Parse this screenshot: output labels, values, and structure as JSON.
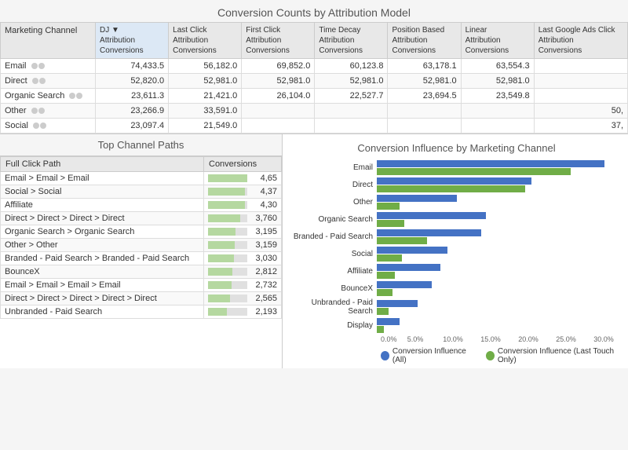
{
  "title": "Conversion Counts by Attribution Model",
  "topTable": {
    "columns": [
      {
        "key": "channel",
        "label": "Marketing Channel"
      },
      {
        "key": "dj",
        "label": "DJ Attribution Conversions",
        "sort": true
      },
      {
        "key": "lastClick",
        "label": "Last Click Attribution Conversions"
      },
      {
        "key": "firstClick",
        "label": "First Click Attribution Conversions"
      },
      {
        "key": "timeDecay",
        "label": "Time Decay Attribution Conversions"
      },
      {
        "key": "positionBased",
        "label": "Position Based Attribution Conversions"
      },
      {
        "key": "linear",
        "label": "Linear Attribution Conversions"
      },
      {
        "key": "lastGoogle",
        "label": "Last Google Ads Click Attribution Conversions"
      }
    ],
    "rows": [
      {
        "channel": "Email",
        "dj": "74,433.5",
        "lastClick": "56,182.0",
        "firstClick": "69,852.0",
        "timeDecay": "60,123.8",
        "positionBased": "63,178.1",
        "linear": "63,554.3",
        "lastGoogle": ""
      },
      {
        "channel": "Direct",
        "dj": "52,820.0",
        "lastClick": "52,981.0",
        "firstClick": "52,981.0",
        "timeDecay": "52,981.0",
        "positionBased": "52,981.0",
        "linear": "52,981.0",
        "lastGoogle": ""
      },
      {
        "channel": "Organic Search",
        "dj": "23,611.3",
        "lastClick": "21,421.0",
        "firstClick": "26,104.0",
        "timeDecay": "22,527.7",
        "positionBased": "23,694.5",
        "linear": "23,549.8",
        "lastGoogle": ""
      },
      {
        "channel": "Other",
        "dj": "23,266.9",
        "lastClick": "33,591.0",
        "firstClick": "",
        "timeDecay": "",
        "positionBased": "",
        "linear": "",
        "lastGoogle": "50,"
      },
      {
        "channel": "Social",
        "dj": "23,097.4",
        "lastClick": "21,549.0",
        "firstClick": "",
        "timeDecay": "",
        "positionBased": "",
        "linear": "",
        "lastGoogle": "37,"
      }
    ]
  },
  "pathsPanel": {
    "title": "Top Channel Paths",
    "columns": [
      "Full Click Path",
      "Conversions"
    ],
    "rows": [
      {
        "path": "Email > Email > Email",
        "value": "4,65",
        "pct": 100
      },
      {
        "path": "Social > Social",
        "value": "4,37",
        "pct": 94
      },
      {
        "path": "Affiliate",
        "value": "4,30",
        "pct": 93
      },
      {
        "path": "Direct > Direct > Direct > Direct",
        "value": "3,760",
        "pct": 81
      },
      {
        "path": "Organic Search > Organic Search",
        "value": "3,195",
        "pct": 69
      },
      {
        "path": "Other > Other",
        "value": "3,159",
        "pct": 68
      },
      {
        "path": "Branded - Paid Search > Branded - Paid Search",
        "value": "3,030",
        "pct": 65
      },
      {
        "path": "BounceX",
        "value": "2,812",
        "pct": 61
      },
      {
        "path": "Email > Email > Email > Email",
        "value": "2,732",
        "pct": 59
      },
      {
        "path": "Direct > Direct > Direct > Direct > Direct",
        "value": "2,565",
        "pct": 55
      },
      {
        "path": "Unbranded - Paid Search",
        "value": "2,193",
        "pct": 47
      }
    ]
  },
  "chart": {
    "title": "Conversion Influence by Marketing Channel",
    "bars": [
      {
        "label": "Email",
        "blue": 100,
        "green": 85
      },
      {
        "label": "Direct",
        "blue": 68,
        "green": 65
      },
      {
        "label": "Other",
        "blue": 35,
        "green": 10
      },
      {
        "label": "Organic Search",
        "blue": 48,
        "green": 12
      },
      {
        "label": "Branded - Paid Search",
        "blue": 46,
        "green": 22
      },
      {
        "label": "Social",
        "blue": 31,
        "green": 11
      },
      {
        "label": "Affiliate",
        "blue": 28,
        "green": 8
      },
      {
        "label": "BounceX",
        "blue": 24,
        "green": 7
      },
      {
        "label": "Unbranded - Paid Search",
        "blue": 18,
        "green": 5
      },
      {
        "label": "Display",
        "blue": 10,
        "green": 3
      }
    ],
    "xTicks": [
      "0.0%",
      "5.0%",
      "10.0%",
      "15.0%",
      "20.0%",
      "25.0%",
      "30.0%"
    ],
    "maxVal": 100,
    "legend": [
      {
        "color": "#4472C4",
        "label": "Conversion Influence (All)"
      },
      {
        "color": "#70AD47",
        "label": "Conversion Influence (Last Touch Only)"
      }
    ]
  }
}
